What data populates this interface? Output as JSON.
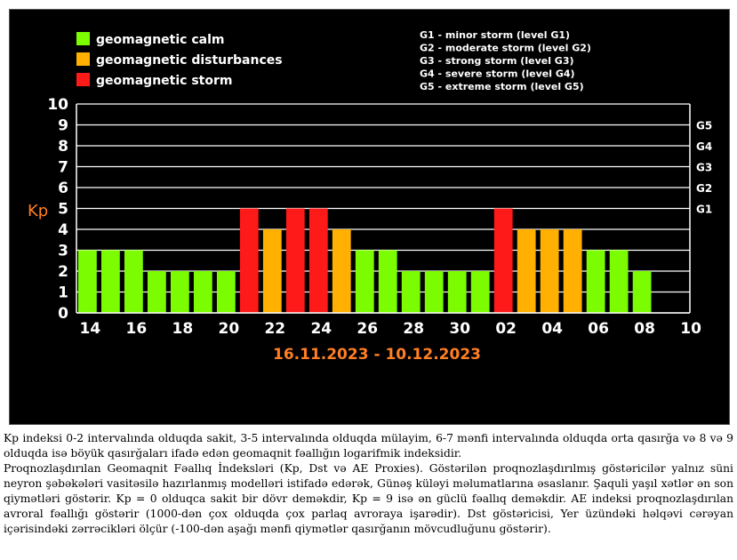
{
  "chart_data": {
    "type": "bar",
    "ylabel": "Kp",
    "ylim": [
      0,
      10
    ],
    "yticks": [
      "0",
      "1",
      "2",
      "3",
      "4",
      "5",
      "6",
      "7",
      "8",
      "9",
      "10"
    ],
    "storm_levels": [
      {
        "tick": "G1",
        "kp": 5
      },
      {
        "tick": "G2",
        "kp": 6
      },
      {
        "tick": "G3",
        "kp": 7
      },
      {
        "tick": "G4",
        "kp": 8
      },
      {
        "tick": "G5",
        "kp": 9
      }
    ],
    "xtick_labels": [
      "14",
      "16",
      "18",
      "20",
      "22",
      "24",
      "26",
      "28",
      "30",
      "02",
      "04",
      "06",
      "08",
      "10"
    ],
    "date_range": "16.11.2023 - 10.12.2023",
    "values": [
      3,
      3,
      3,
      2,
      2,
      2,
      2,
      5,
      4,
      5,
      5,
      4,
      3,
      3,
      2,
      2,
      2,
      2,
      5,
      4,
      4,
      4,
      3,
      3,
      2
    ],
    "categories_colors": [
      "#7cfc00",
      "#ffb000",
      "#ff1a1a"
    ],
    "legend": [
      {
        "label": "geomagnetic calm",
        "color": "#7cfc00"
      },
      {
        "label": "geomagnetic disturbances",
        "color": "#ffb000"
      },
      {
        "label": "geomagnetic storm",
        "color": "#ff1a1a"
      }
    ],
    "storm_legend": [
      "G1 - minor storm (level G1)",
      "G2 - moderate storm (level G2)",
      "G3 - strong storm (level G3)",
      "G4 - severe storm (level G4)",
      "G5 - extreme storm (level G5)"
    ],
    "grid": true,
    "legend_position": "top-left"
  },
  "description": {
    "paragraph1": "Kp indeksi 0-2 intervalında olduqda sakit, 3-5 intervalında olduqda mülayim, 6-7 mənfi intervalında olduqda orta qasırğa və 8 və 9 olduqda isə böyük qasırğaları ifadə edən geomaqnit fəallığın logarifmik indeksidir.",
    "paragraph2": "Proqnozlaşdırılan Geomaqnit Fəallıq İndeksləri (Kp, Dst və AE Proxies). Göstərilən proqnozlaşdırılmış göstəricilər yalnız süni neyron şəbəkələri vasitəsilə hazırlanmış modelləri istifadə edərək, Günəş küləyi məlumatlarına əsaslanır. Şaquli yaşıl xətlər ən son qiymətləri göstərir. Kp = 0 olduqca sakit bir dövr deməkdir, Kp = 9 isə ən güclü fəallıq deməkdir. AE indeksi proqnozlaşdırılan avroral fəallığı göstərir (1000-dən çox olduqda çox parlaq avroraya işarədir). Dst göstəricisi, Yer üzündəki həlqəvi cərəyan içərisindəki zərrəcikləri ölçür (-100-dən aşağı mənfi qiymətlər qasırğanın mövcudluğunu göstərir)."
  }
}
